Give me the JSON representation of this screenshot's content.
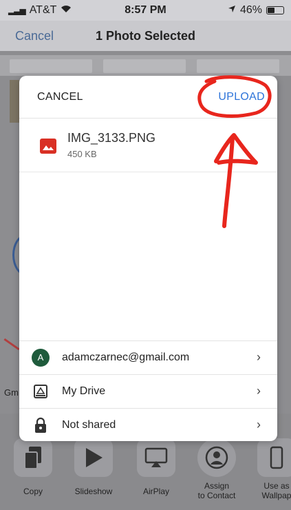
{
  "status_bar": {
    "carrier": "AT&T",
    "time": "8:57 PM",
    "battery": "46%",
    "battery_level": 0.46
  },
  "nav_bar": {
    "cancel_label": "Cancel",
    "title": "1 Photo Selected"
  },
  "background": {
    "partial_label": "Gm"
  },
  "share_actions": [
    {
      "label": "Copy",
      "icon": "copy-icon"
    },
    {
      "label": "Slideshow",
      "icon": "play-icon"
    },
    {
      "label": "AirPlay",
      "icon": "airplay-icon"
    },
    {
      "label": "Assign\nto Contact",
      "icon": "contact-icon"
    },
    {
      "label": "Use as\nWallpap",
      "icon": "phone-icon"
    }
  ],
  "upload_sheet": {
    "cancel_label": "CANCEL",
    "upload_label": "UPLOAD",
    "file": {
      "name": "IMG_3133.PNG",
      "size": "450 KB",
      "icon": "image-file-icon"
    },
    "account": {
      "initial": "A",
      "email": "adamczarnec@gmail.com"
    },
    "folder": {
      "label": "My Drive",
      "icon": "drive-folder-icon"
    },
    "sharing": {
      "label": "Not shared",
      "icon": "lock-icon"
    },
    "chevron": "›"
  },
  "colors": {
    "accent": "#2c73d9",
    "annotation": "#e8261d",
    "file_icon": "#d93025"
  }
}
